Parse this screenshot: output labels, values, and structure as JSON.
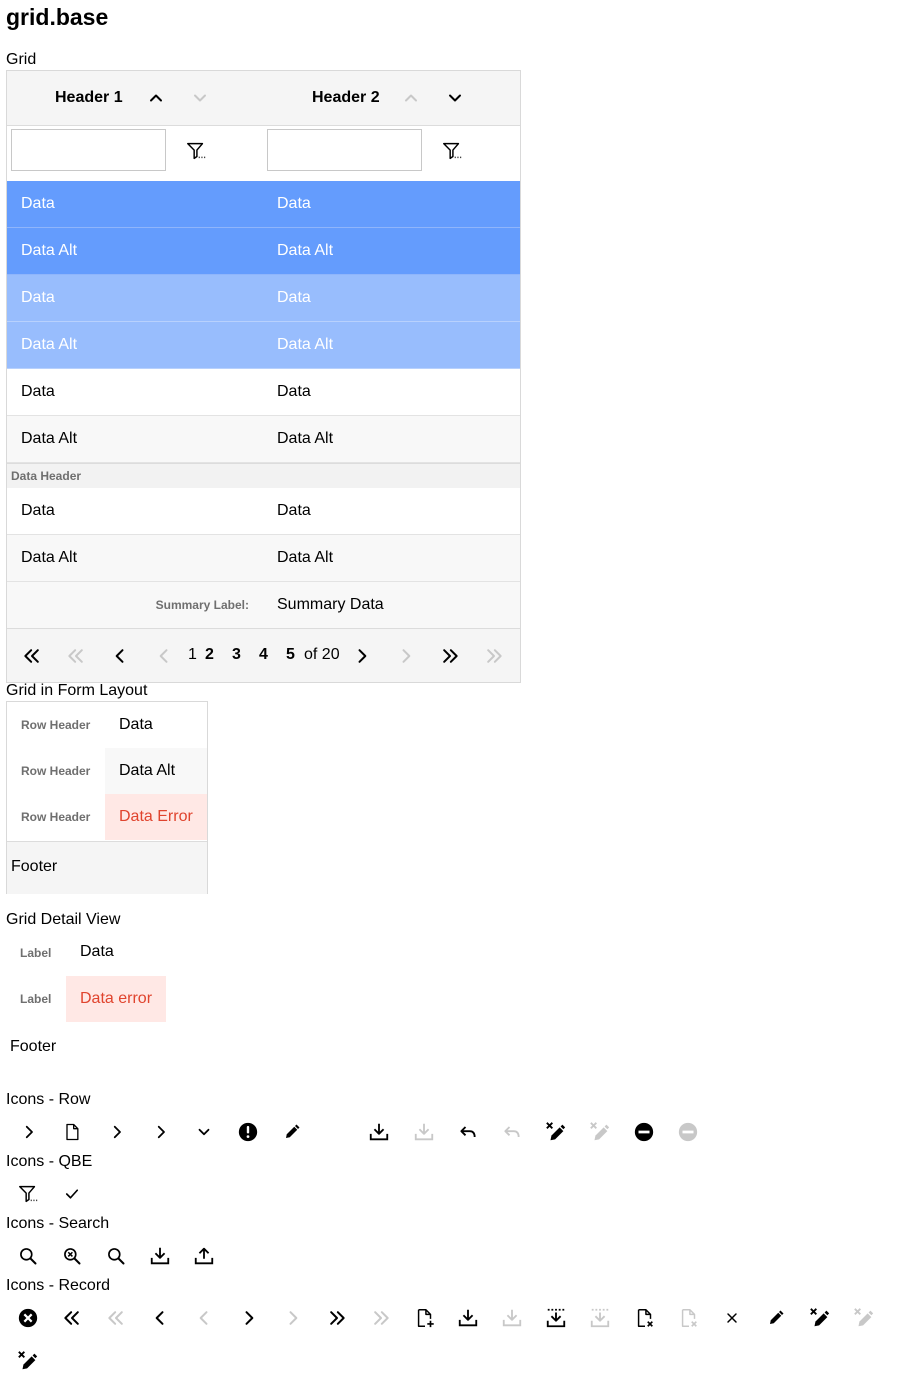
{
  "page_title": "grid.base",
  "grid": {
    "label": "Grid",
    "headers": [
      "Header 1",
      "Header 2"
    ],
    "rows": [
      {
        "c1": "Data",
        "c2": "Data"
      },
      {
        "c1": "Data Alt",
        "c2": "Data Alt"
      },
      {
        "c1": "Data",
        "c2": "Data"
      },
      {
        "c1": "Data Alt",
        "c2": "Data Alt"
      },
      {
        "c1": "Data",
        "c2": "Data"
      },
      {
        "c1": "Data Alt",
        "c2": "Data Alt"
      }
    ],
    "data_header": "Data Header",
    "rows_after": [
      {
        "c1": "Data",
        "c2": "Data"
      },
      {
        "c1": "Data Alt",
        "c2": "Data Alt"
      }
    ],
    "summary_label": "Summary Label:",
    "summary_data": "Summary Data",
    "pager": {
      "pages": [
        "1",
        "2",
        "3",
        "4",
        "5"
      ],
      "total": "of 20"
    }
  },
  "form": {
    "label": "Grid in Form Layout",
    "rows": [
      {
        "header": "Row Header",
        "value": "Data"
      },
      {
        "header": "Row Header",
        "value": "Data Alt"
      },
      {
        "header": "Row Header",
        "value": "Data Error"
      }
    ],
    "footer": "Footer"
  },
  "detail": {
    "label": "Grid Detail View",
    "items": [
      {
        "label": "Label",
        "value": "Data"
      },
      {
        "label": "Label",
        "value": "Data error"
      }
    ],
    "footer": "Footer"
  },
  "icons": {
    "row_label": "Icons - Row",
    "qbe_label": "Icons - QBE",
    "search_label": "Icons - Search",
    "record_label": "Icons - Record"
  },
  "colors": {
    "selected": "#649cfd",
    "selected_light": "#98bdfd",
    "error": "#e0442e",
    "error_bg": "#ffe8e5"
  }
}
